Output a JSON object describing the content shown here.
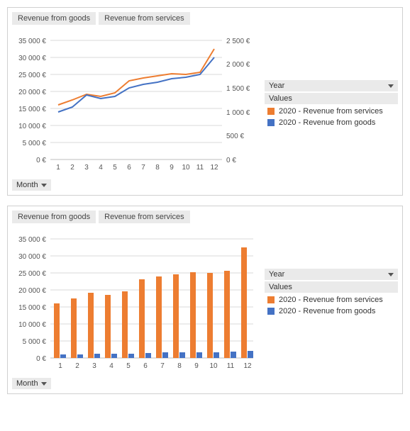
{
  "tabs": {
    "goods": "Revenue from goods",
    "services": "Revenue from services"
  },
  "controls": {
    "month_label": "Month",
    "year_label": "Year",
    "values_label": "Values"
  },
  "legend": {
    "services": "2020 - Revenue from services",
    "goods": "2020 - Revenue from goods"
  },
  "chart_data": [
    {
      "type": "line",
      "title": "",
      "xlabel": "Month",
      "axes": [
        {
          "side": "left",
          "ylim": [
            0,
            35000
          ],
          "ticks": [
            "0 €",
            "5 000 €",
            "10 000 €",
            "15 000 €",
            "20 000 €",
            "25 000 €",
            "30 000 €",
            "35 000 €"
          ]
        },
        {
          "side": "right",
          "ylim": [
            0,
            2500
          ],
          "ticks": [
            "0 €",
            "500 €",
            "1 000 €",
            "1 500 €",
            "2 000 €",
            "2 500 €"
          ]
        }
      ],
      "categories": [
        1,
        2,
        3,
        4,
        5,
        6,
        7,
        8,
        9,
        10,
        11,
        12
      ],
      "series": [
        {
          "name": "2020 - Revenue from services",
          "axis": "left",
          "color": "#ed7d31",
          "values": [
            16000,
            17500,
            19100,
            18500,
            19500,
            23100,
            24000,
            24500,
            25200,
            24900,
            25600,
            32500
          ]
        },
        {
          "name": "2020 - Revenue from goods",
          "axis": "right",
          "color": "#4472c4",
          "values": [
            1000,
            1100,
            1350,
            1280,
            1330,
            1500,
            1580,
            1620,
            1700,
            1720,
            1780,
            2150
          ]
        }
      ]
    },
    {
      "type": "bar",
      "title": "",
      "xlabel": "Month",
      "axes": [
        {
          "side": "left",
          "ylim": [
            0,
            35000
          ],
          "ticks": [
            "0 €",
            "5 000 €",
            "10 000 €",
            "15 000 €",
            "20 000 €",
            "25 000 €",
            "30 000 €",
            "35 000 €"
          ]
        }
      ],
      "categories": [
        1,
        2,
        3,
        4,
        5,
        6,
        7,
        8,
        9,
        10,
        11,
        12
      ],
      "series": [
        {
          "name": "2020 - Revenue from services",
          "color": "#ed7d31",
          "values": [
            16000,
            17500,
            19100,
            18500,
            19500,
            23100,
            24000,
            24500,
            25200,
            24900,
            25600,
            32500
          ]
        },
        {
          "name": "2020 - Revenue from goods",
          "color": "#4472c4",
          "values": [
            1000,
            1100,
            1350,
            1280,
            1330,
            1500,
            1580,
            1620,
            1700,
            1720,
            1780,
            2150
          ]
        }
      ]
    }
  ],
  "axis_ticks": {
    "leftY": [
      "0 €",
      "5 000 €",
      "10 000 €",
      "15 000 €",
      "20 000 €",
      "25 000 €",
      "30 000 €",
      "35 000 €"
    ],
    "rightY": [
      "0 €",
      "500 €",
      "1 000 €",
      "1 500 €",
      "2 000 €",
      "2 500 €"
    ],
    "x": [
      "1",
      "2",
      "3",
      "4",
      "5",
      "6",
      "7",
      "8",
      "9",
      "10",
      "11",
      "12"
    ]
  }
}
